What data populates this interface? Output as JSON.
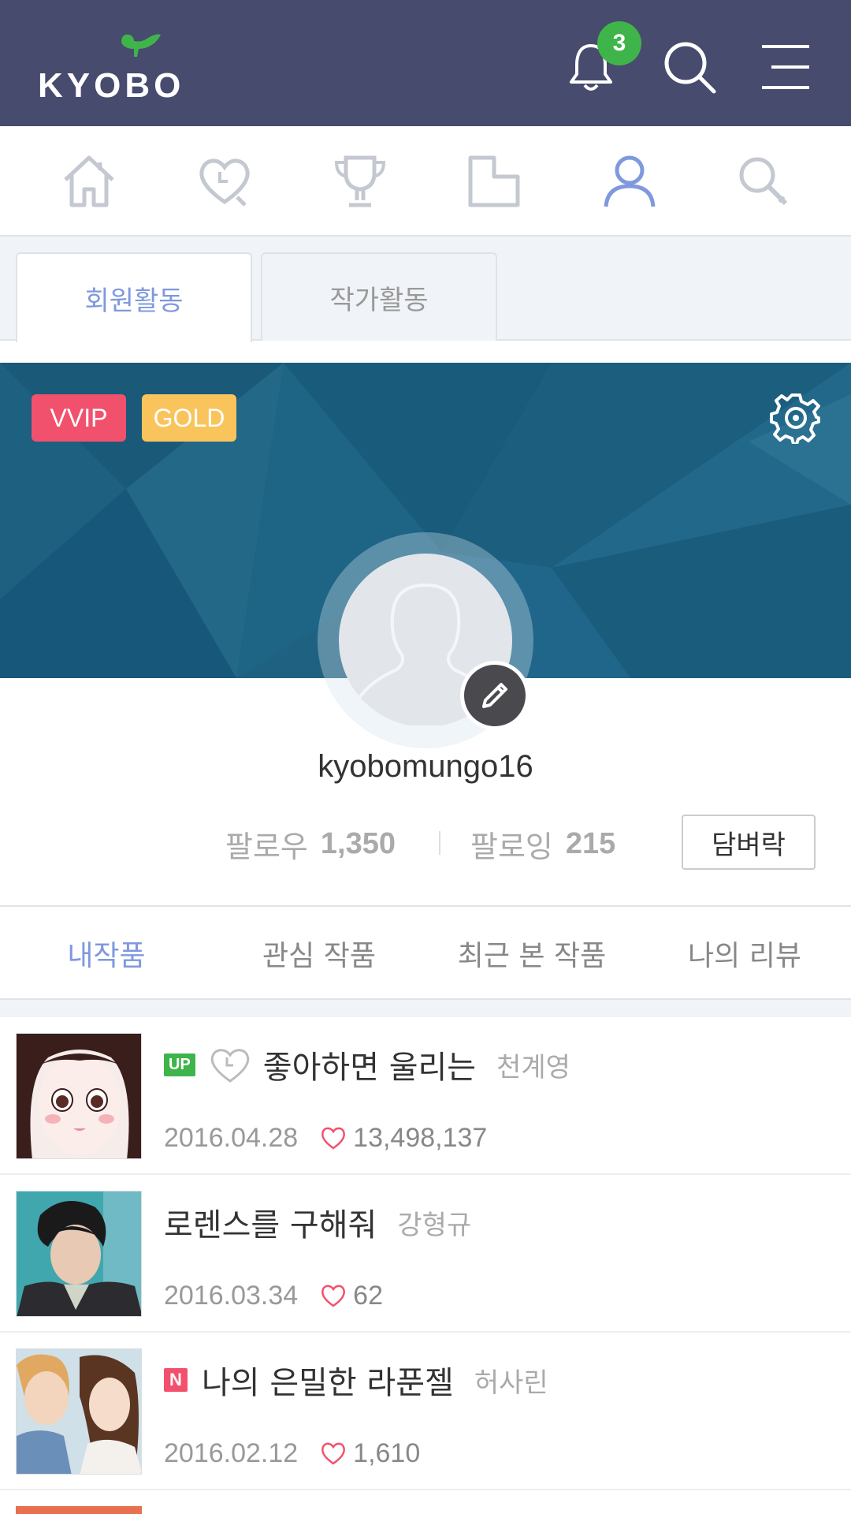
{
  "header": {
    "logo_text": "KYOBO",
    "notification_count": "3",
    "icons": [
      "bell-icon",
      "search-icon",
      "menu-icon"
    ]
  },
  "icon_nav": {
    "items": [
      "home-icon",
      "heart-clock-icon",
      "trophy-icon",
      "stairs-icon",
      "user-icon",
      "search-icon"
    ],
    "active": "user-icon",
    "active_color": "#7f98de"
  },
  "activity_tabs": {
    "member": "회원활동",
    "author": "작가활동"
  },
  "profile": {
    "grade_badges": [
      "VVIP",
      "GOLD"
    ],
    "username": "kyobomungo16",
    "follower_label": "팔로우",
    "follower_count": "1,350",
    "following_label": "팔로잉",
    "following_count": "215",
    "wall_button": "담벼락"
  },
  "content_tabs": [
    "내작품",
    "관심 작품",
    "최근 본 작품",
    "나의 리뷰"
  ],
  "works": [
    {
      "tag": "UP",
      "title": "좋아하면 울리는",
      "author": "천계영",
      "date": "2016.04.28",
      "likes": "13,498,137"
    },
    {
      "tag": "",
      "title": "로렌스를 구해줘",
      "author": "강형규",
      "date": "2016.03.34",
      "likes": "62"
    },
    {
      "tag": "N",
      "title": "나의 은밀한 라푼젤",
      "author": "허사린",
      "date": "2016.02.12",
      "likes": "1,610"
    }
  ],
  "colors": {
    "header_bg": "#474b6e",
    "accent": "#7f98de",
    "badge_green": "#3fb44a",
    "vvip": "#f2516e",
    "gold": "#f9c45c",
    "banner": "#1f6180"
  }
}
